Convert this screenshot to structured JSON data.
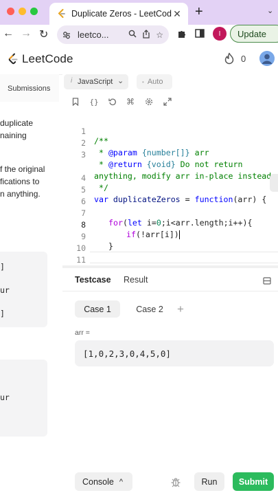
{
  "browser": {
    "tab_title": "Duplicate Zeros - LeetCode",
    "tab_close": "✕",
    "new_tab": "+",
    "tab_menu": "⌄",
    "url": "leetco...",
    "profile_initial": "I",
    "update_label": "Update",
    "colors": {
      "tabbar": "#e3d2f5",
      "update_border": "#4a8b4a"
    }
  },
  "header": {
    "brand": "LeetCode",
    "streak_count": "0"
  },
  "left_panel": {
    "submissions_tab": "Submissions",
    "description_lines": [
      "duplicate",
      "naining",
      "f the original",
      "fications to",
      "n anything."
    ],
    "example1_lines": [
      "]",
      "ur",
      "]"
    ],
    "example2_lines": [
      "ur"
    ]
  },
  "editor": {
    "language": "JavaScript",
    "language_chevron": "⌄",
    "auto_label": "Auto",
    "line_numbers": [
      "1",
      "2",
      "3",
      "",
      "4",
      "5",
      "6",
      "7",
      "8",
      "9",
      "10",
      "11"
    ],
    "code": {
      "l1": "/**",
      "l2_star": " * ",
      "l2_tag": "@param",
      "l2_type": " {number[]}",
      "l2_rest": " arr",
      "l3_star": " * ",
      "l3_tag": "@return",
      "l3_type": " {void}",
      "l3_rest": " Do not return",
      "l3_wrap": "anything, modify arr in-place instead.",
      "l4": " */",
      "l5_var": "var",
      "l5_name": " duplicateZeros",
      "l5_eq": " = ",
      "l5_fn": "function",
      "l5_rest": "(arr) {",
      "l7_for": "for",
      "l7_open": "(",
      "l7_let": "let",
      "l7_i": " i=",
      "l7_zero": "0",
      "l7_rest": ";i<arr.length;i++){",
      "l8_if": "if",
      "l8_rest": "(!arr[i])",
      "l9": "}",
      "l11": "};"
    }
  },
  "testcase": {
    "tab_testcase": "Testcase",
    "tab_result": "Result",
    "case1": "Case 1",
    "case2": "Case 2",
    "add_case": "+",
    "arr_label": "arr =",
    "arr_value": "[1,0,2,3,0,4,5,0]",
    "console_label": "Console",
    "console_chevron": "^",
    "run_label": "Run",
    "submit_label": "Submit",
    "colors": {
      "submit": "#2cbb5d"
    }
  }
}
